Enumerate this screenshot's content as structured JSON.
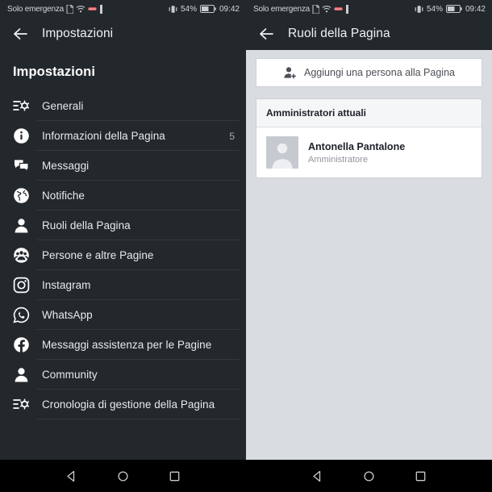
{
  "status_bar": {
    "carrier": "Solo emergenza",
    "battery_percent": "54%",
    "time": "09:42",
    "icons": [
      "sim-card-icon",
      "wifi-icon",
      "alarm-icon",
      "usb-icon",
      "vibrate-icon",
      "battery-icon"
    ]
  },
  "left_panel": {
    "appbar": {
      "back_icon": "back-arrow-icon",
      "title": "Impostazioni"
    },
    "section_title": "Impostazioni",
    "items": [
      {
        "label": "Generali",
        "icon": "sliders-settings-icon",
        "badge": ""
      },
      {
        "label": "Informazioni della Pagina",
        "icon": "info-circle-icon",
        "badge": "5"
      },
      {
        "label": "Messaggi",
        "icon": "chat-bubbles-icon",
        "badge": ""
      },
      {
        "label": "Notifiche",
        "icon": "globe-icon",
        "badge": ""
      },
      {
        "label": "Ruoli della Pagina",
        "icon": "person-icon",
        "badge": ""
      },
      {
        "label": "Persone e altre Pagine",
        "icon": "group-people-icon",
        "badge": ""
      },
      {
        "label": "Instagram",
        "icon": "instagram-icon",
        "badge": ""
      },
      {
        "label": "WhatsApp",
        "icon": "whatsapp-icon",
        "badge": ""
      },
      {
        "label": "Messaggi assistenza per le Pagine",
        "icon": "facebook-icon",
        "badge": ""
      },
      {
        "label": "Community",
        "icon": "person-icon",
        "badge": ""
      },
      {
        "label": "Cronologia di gestione della Pagina",
        "icon": "sliders-settings-icon",
        "badge": ""
      }
    ]
  },
  "right_panel": {
    "appbar": {
      "back_icon": "back-arrow-icon",
      "title": "Ruoli della Pagina"
    },
    "add_person_button": {
      "label": "Aggiungi una persona alla Pagina",
      "icon": "add-person-icon"
    },
    "admins_card": {
      "header": "Amministratori attuali",
      "people": [
        {
          "name": "Antonella Pantalone",
          "role": "Amministratore",
          "avatar": "default-avatar-icon"
        }
      ]
    }
  },
  "nav_bar": {
    "buttons": [
      {
        "name": "back",
        "icon": "triangle-back-icon"
      },
      {
        "name": "home",
        "icon": "circle-home-icon"
      },
      {
        "name": "recents",
        "icon": "square-recents-icon"
      }
    ]
  },
  "colors": {
    "dark_chrome": "#23282c",
    "light_bg": "#d9dde1",
    "card_white": "#ffffff",
    "divider": "#35393d",
    "text_primary": "#e8eaec",
    "text_muted": "#90949c"
  }
}
